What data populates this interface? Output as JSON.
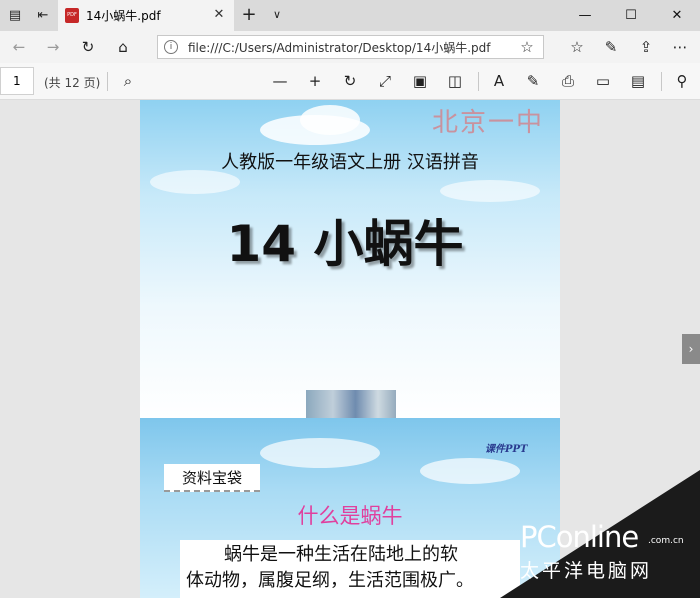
{
  "titlebar": {
    "tab_title": "14小蜗牛.pdf",
    "icons": [
      "tab-preview-icon",
      "set-aside-tabs-icon",
      "pdf-file-icon",
      "close-icon",
      "plus-icon",
      "chevron-down-icon",
      "minimize-icon",
      "maximize-icon",
      "close-window-icon"
    ]
  },
  "nav": {
    "url": "file:///C:/Users/Administrator/Desktop/14小蜗牛.pdf",
    "icons": [
      "back-icon",
      "forward-icon",
      "refresh-icon",
      "home-icon",
      "info-icon",
      "star-icon",
      "favorites-icon",
      "pen-icon",
      "share-icon",
      "more-icon"
    ]
  },
  "pdf_toolbar": {
    "page_number": "1",
    "page_total": "(共 12 页)",
    "icons": [
      "search-icon",
      "zoom-out-icon",
      "zoom-in-icon",
      "rotate-icon",
      "fit-icon",
      "fullscreen-icon",
      "page-view-icon",
      "read-aloud-icon",
      "draw-icon",
      "print-icon",
      "save-icon",
      "save-as-icon",
      "pin-icon"
    ]
  },
  "slide1": {
    "watermark": "北京一中",
    "subtitle": "人教版一年级语文上册   汉语拼音",
    "title": "14 小蜗牛"
  },
  "slide2": {
    "credit": "课件PPT",
    "tag": "资料宝袋",
    "question": "什么是蜗牛",
    "body_line1": "蜗牛是一种生活在陆地上的软",
    "body_line2": "体动物，属腹足纲，生活范围极广。"
  },
  "logo": {
    "main": "PConline",
    "sub": ".com.cn",
    "cn": "太平洋电脑网"
  },
  "colors": {
    "watermark": "#c9929e",
    "question": "#e0409e",
    "credit": "#2a3b8f"
  }
}
